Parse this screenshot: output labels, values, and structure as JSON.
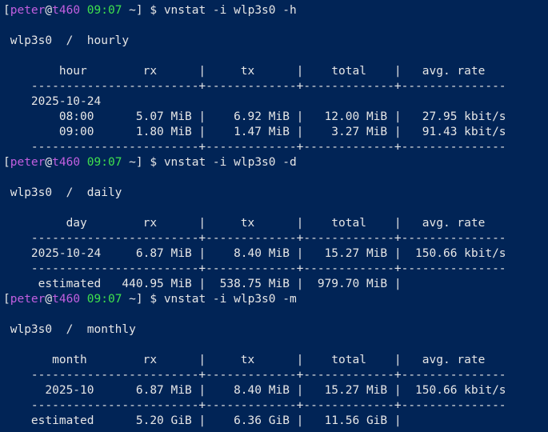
{
  "colors": {
    "background": "#012456",
    "foreground": "#e6e6e6",
    "user": "#c25fe0",
    "host": "#c25fe0",
    "time": "#3fe04d"
  },
  "prompt": {
    "user": "peter",
    "host": "t460",
    "time": "09:07",
    "dir": "~"
  },
  "commands": [
    "vnstat -i wlp3s0 -h",
    "vnstat -i wlp3s0 -d",
    "vnstat -i wlp3s0 -m"
  ],
  "output": {
    "hourly": {
      "title": " wlp3s0  /  hourly",
      "header": "        hour        rx      |     tx      |    total    |   avg. rate",
      "separator": "    ------------------------+-------------+-------------+---------------",
      "date": "    2025-10-24",
      "rows": [
        "        08:00      5.07 MiB |    6.92 MiB |   12.00 MiB |   27.95 kbit/s",
        "        09:00      1.80 MiB |    1.47 MiB |    3.27 MiB |   91.43 kbit/s"
      ],
      "separator_bottom": "    ------------------------+-------------+-------------+---------------"
    },
    "daily": {
      "title": " wlp3s0  /  daily",
      "header": "         day        rx      |     tx      |    total    |   avg. rate",
      "separator": "    ------------------------+-------------+-------------+---------------",
      "row": "    2025-10-24     6.87 MiB |    8.40 MiB |   15.27 MiB |  150.66 kbit/s",
      "separator_bottom": "    ------------------------+-------------+-------------+---------------",
      "estimated": "     estimated   440.95 MiB |  538.75 MiB |  979.70 MiB |"
    },
    "monthly": {
      "title": " wlp3s0  /  monthly",
      "header": "       month        rx      |     tx      |    total    |   avg. rate",
      "separator": "    ------------------------+-------------+-------------+---------------",
      "row": "      2025-10      6.87 MiB |    8.40 MiB |   15.27 MiB |  150.66 kbit/s",
      "separator_bottom": "    ------------------------+-------------+-------------+---------------",
      "estimated": "    estimated      5.20 GiB |    6.36 GiB |   11.56 GiB |"
    }
  }
}
